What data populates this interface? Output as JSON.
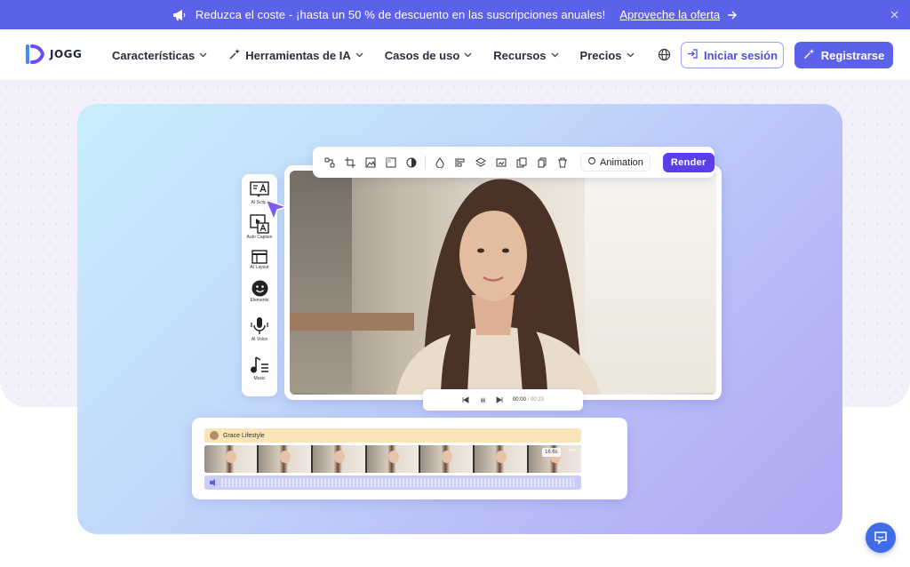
{
  "promo": {
    "message": "Reduzca el coste - ¡hasta un 50 % de descuento en las suscripciones anuales!",
    "cta": "Aproveche la oferta",
    "icon": "megaphone-icon"
  },
  "nav": {
    "logo_text": "JOGG",
    "menu": [
      {
        "label": "Características"
      },
      {
        "label": "Herramientas de IA"
      },
      {
        "label": "Casos de uso"
      },
      {
        "label": "Recursos"
      },
      {
        "label": "Precios"
      }
    ],
    "login": "Iniciar sesión",
    "signup": "Registrarse"
  },
  "editor": {
    "side_tools": [
      {
        "label": "AI Script",
        "icon": "text-icon"
      },
      {
        "label": "Auto Caption",
        "icon": "caption-icon"
      },
      {
        "label": "AI Layout",
        "icon": "layout-icon"
      },
      {
        "label": "Elements",
        "icon": "smiley-icon"
      },
      {
        "label": "AI Voice",
        "icon": "microphone-icon"
      },
      {
        "label": "Music",
        "icon": "music-icon"
      }
    ],
    "toolbar": {
      "animation": "Animation",
      "render": "Render"
    },
    "playback": {
      "current": "00:00",
      "total": "/ 00:23"
    },
    "timeline": {
      "track_name": "Grace Lifestyle",
      "duration": "16.6s"
    }
  },
  "colors": {
    "brand": "#5b61e8",
    "render": "#5b3ee8",
    "chat": "#3f6ce8"
  }
}
